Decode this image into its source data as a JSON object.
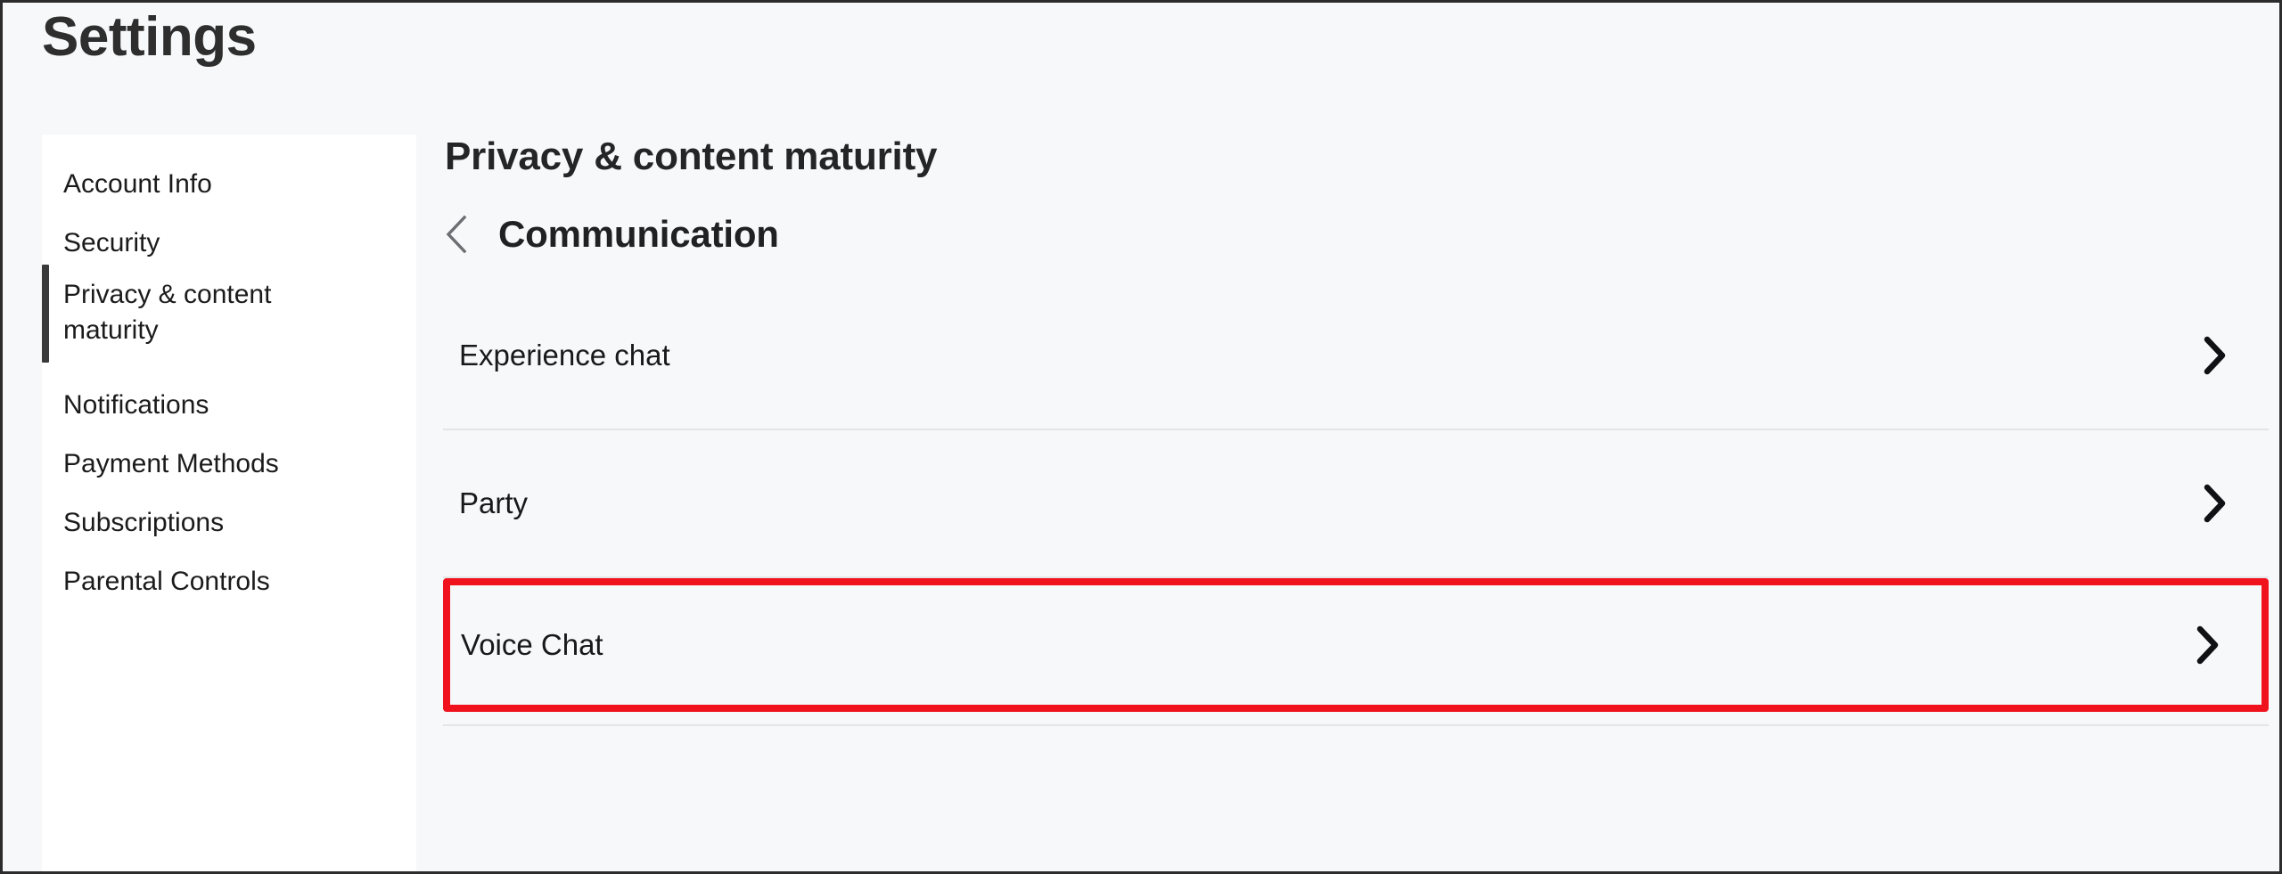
{
  "page": {
    "title": "Settings"
  },
  "sidebar": {
    "items": [
      {
        "label": "Account Info",
        "active": false
      },
      {
        "label": "Security",
        "active": false
      },
      {
        "label": "Privacy & content maturity",
        "active": true
      },
      {
        "label": "Notifications",
        "active": false
      },
      {
        "label": "Payment Methods",
        "active": false
      },
      {
        "label": "Subscriptions",
        "active": false
      },
      {
        "label": "Parental Controls",
        "active": false
      }
    ]
  },
  "main": {
    "section_title": "Privacy & content maturity",
    "back_icon": "chevron-left-icon",
    "subheader_title": "Communication",
    "rows": [
      {
        "label": "Experience chat",
        "chevron": "chevron-right-icon",
        "highlighted": false
      },
      {
        "label": "Party",
        "chevron": "chevron-right-icon",
        "highlighted": false
      },
      {
        "label": "Voice Chat",
        "chevron": "chevron-right-icon",
        "highlighted": true
      }
    ]
  },
  "colors": {
    "highlight_border": "#f0131e",
    "active_indicator": "#3a3a3a",
    "text_primary": "#18191a",
    "divider": "#e3e5e7",
    "background": "#f7f8f9",
    "panel": "#ffffff"
  }
}
